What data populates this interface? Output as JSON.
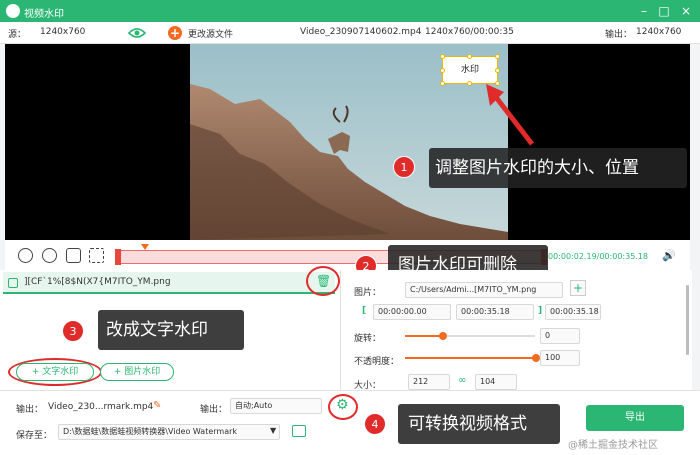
{
  "window": {
    "title": "视频水印",
    "accent": "#2bb673"
  },
  "info": {
    "source_label": "源：",
    "source_res": "1240x760",
    "change_source": "更改源文件",
    "file": "Video_230907140602.mp4",
    "file_meta": "1240x760/00:00:35",
    "output_label": "输出：",
    "output_res": "1240x760"
  },
  "watermark_label": "水印",
  "callouts": [
    {
      "num": "1",
      "text": "调整图片水印的大小、位置"
    },
    {
      "num": "2",
      "text": "图片水印可删除"
    },
    {
      "num": "3",
      "text": "改成文字水印"
    },
    {
      "num": "4",
      "text": "可转换视频格式"
    }
  ],
  "player": {
    "time": "00:00:02.19/00:00:35.18",
    "progress": 0.07
  },
  "list": {
    "item_name": "][CF`1%[8$N(X7{M7ITO_YM.png"
  },
  "buttons": {
    "text_wm": "文字水印",
    "image_wm": "图片水印",
    "export": "导出"
  },
  "props": {
    "image_label": "图片：",
    "image_path": "C:/Users/Admi...[M7ITO_YM.png",
    "start": "00:00:00.00",
    "end": "00:00:35.18",
    "range_end": "00:00:35.18",
    "rotate_label": "旋转：",
    "rotate_value": "0",
    "opacity_label": "不透明度：",
    "opacity_value": "100",
    "size_label": "大小：",
    "width": "212",
    "height": "104"
  },
  "bottom": {
    "output_label": "输出：",
    "output_name": "Video_230...rmark.mp4",
    "format_label": "输出：",
    "format_value": "自动;Auto",
    "save_label": "保存至：",
    "save_path": "D:\\数据蛙\\数据蛙视频转换器\\Video Watermark"
  },
  "watermark_site": "@稀土掘金技术社区"
}
